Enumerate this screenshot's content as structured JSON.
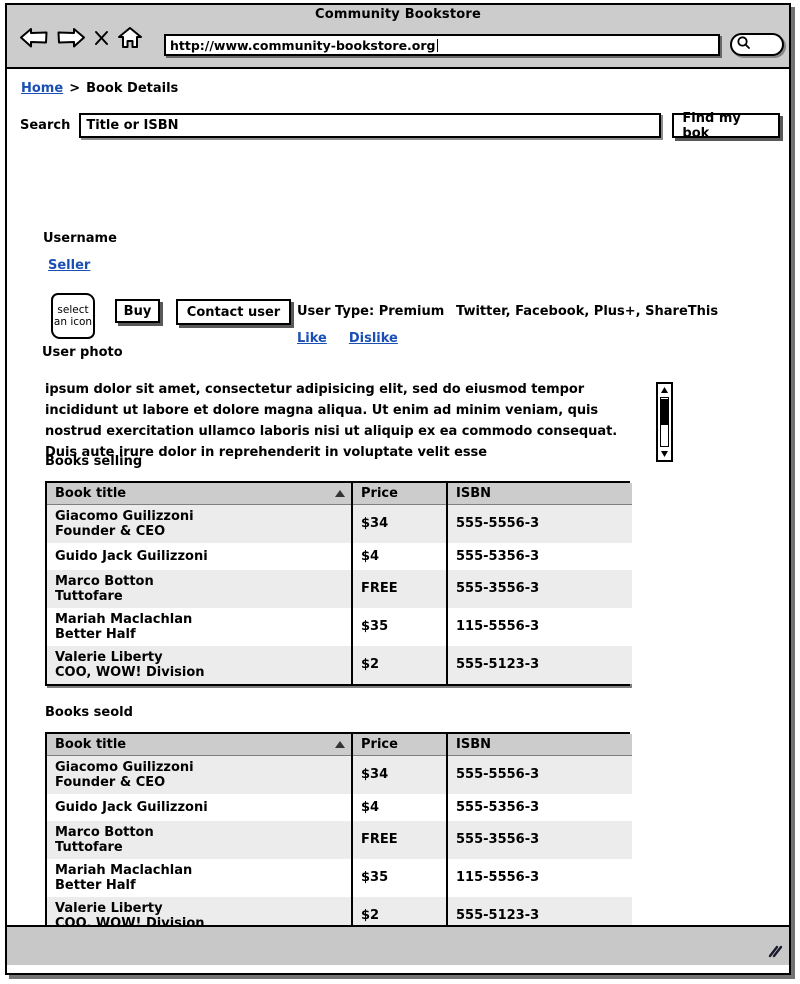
{
  "window": {
    "title": "Community Bookstore",
    "url": "http://www.community-bookstore.org",
    "nav_icons": [
      "back-arrow-icon",
      "forward-arrow-icon",
      "stop-x-icon",
      "home-icon"
    ],
    "chrome_search_icon": "magnifier-icon"
  },
  "breadcrumb": {
    "home_label": "Home",
    "separator": ">",
    "current_label": "Book Details"
  },
  "search": {
    "label": "Search",
    "placeholder": "Title or ISBN",
    "value": "",
    "button_label": "Find my bok"
  },
  "profile": {
    "username_label": "Username",
    "seller_link": "Seller",
    "photo_placeholder_line1": "select",
    "photo_placeholder_line2": "an icon",
    "photo_caption": "User photo",
    "buy_label": "Buy",
    "contact_label": "Contact user",
    "user_type": "User Type: Premium",
    "social_share": "Twitter, Facebook, Plus+, ShareThis",
    "like_label": "Like",
    "dislike_label": "Dislike"
  },
  "description": {
    "text": "ipsum dolor sit amet, consectetur adipisicing elit, sed do eiusmod tempor incididunt ut labore et dolore magna aliqua. Ut enim ad minim veniam, quis nostrud exercitation ullamco laboris nisi ut aliquip ex ea commodo consequat. Duis aute irure dolor in reprehenderit in voluptate velit esse",
    "scrollbar_up_icon": "scroll-up-arrow-icon",
    "scrollbar_down_icon": "scroll-down-arrow-icon"
  },
  "tables": [
    {
      "section_label": "Books selling",
      "columns": [
        "Book title",
        "Price",
        "ISBN"
      ],
      "sort_column": "Book title",
      "sort_direction": "asc",
      "rows": [
        {
          "title": "Giacomo Guilizzoni",
          "subtitle": "Founder & CEO",
          "price": "$34",
          "isbn": "555-5556-3"
        },
        {
          "title": "Guido Jack Guilizzoni",
          "subtitle": "",
          "price": "$4",
          "isbn": "555-5356-3"
        },
        {
          "title": "Marco Botton",
          "subtitle": "Tuttofare",
          "price": "FREE",
          "isbn": "555-3556-3"
        },
        {
          "title": "Mariah Maclachlan",
          "subtitle": "Better Half",
          "price": "$35",
          "isbn": "115-5556-3"
        },
        {
          "title": "Valerie Liberty",
          "subtitle": "COO, WOW! Division",
          "price": "$2",
          "isbn": "555-5123-3"
        }
      ]
    },
    {
      "section_label": "Books seold",
      "columns": [
        "Book title",
        "Price",
        "ISBN"
      ],
      "sort_column": "Book title",
      "sort_direction": "asc",
      "rows": [
        {
          "title": "Giacomo Guilizzoni",
          "subtitle": "Founder & CEO",
          "price": "$34",
          "isbn": "555-5556-3"
        },
        {
          "title": "Guido Jack Guilizzoni",
          "subtitle": "",
          "price": "$4",
          "isbn": "555-5356-3"
        },
        {
          "title": "Marco Botton",
          "subtitle": "Tuttofare",
          "price": "FREE",
          "isbn": "555-3556-3"
        },
        {
          "title": "Mariah Maclachlan",
          "subtitle": "Better Half",
          "price": "$35",
          "isbn": "115-5556-3"
        },
        {
          "title": "Valerie Liberty",
          "subtitle": "COO, WOW! Division",
          "price": "$2",
          "isbn": "555-5123-3"
        }
      ]
    }
  ],
  "statusbar": {
    "text": "",
    "resize_grip_icon": "resize-grip-icon"
  }
}
